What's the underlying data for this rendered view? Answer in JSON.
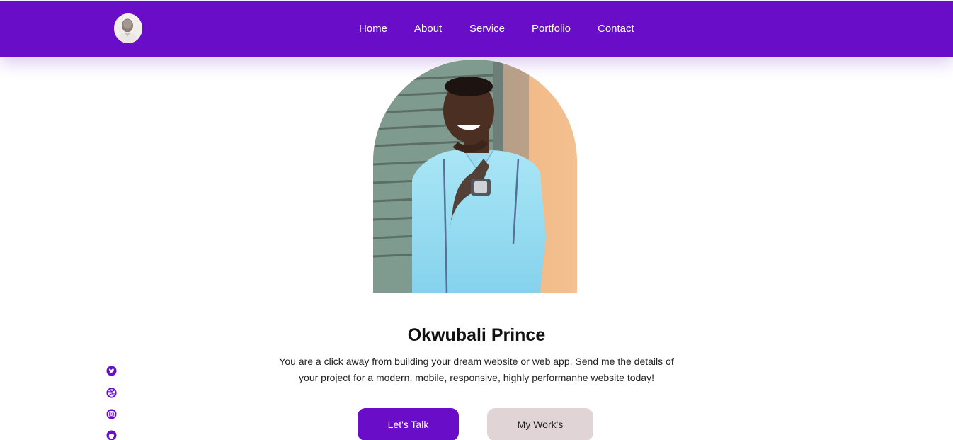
{
  "brand": {
    "accent": "#6a0dc8",
    "secondary_button": "#e0d4d6"
  },
  "header": {
    "logo_icon": "profile-avatar-icon",
    "nav": [
      {
        "label": "Home"
      },
      {
        "label": "About"
      },
      {
        "label": "Service"
      },
      {
        "label": "Portfolio"
      },
      {
        "label": "Contact"
      }
    ]
  },
  "hero": {
    "photo_icon": "portrait-photo",
    "name": "Okwubali Prince",
    "bio": "You are a click away from building your dream website or web app. Send me the details of your project for a modern, mobile, responsive, highly performanhe website today!",
    "buttons": {
      "primary": "Let's Talk",
      "secondary": "My Work's"
    }
  },
  "socials": [
    {
      "icon": "twitter-icon"
    },
    {
      "icon": "dribbble-icon"
    },
    {
      "icon": "instagram-icon"
    },
    {
      "icon": "github-icon"
    }
  ]
}
